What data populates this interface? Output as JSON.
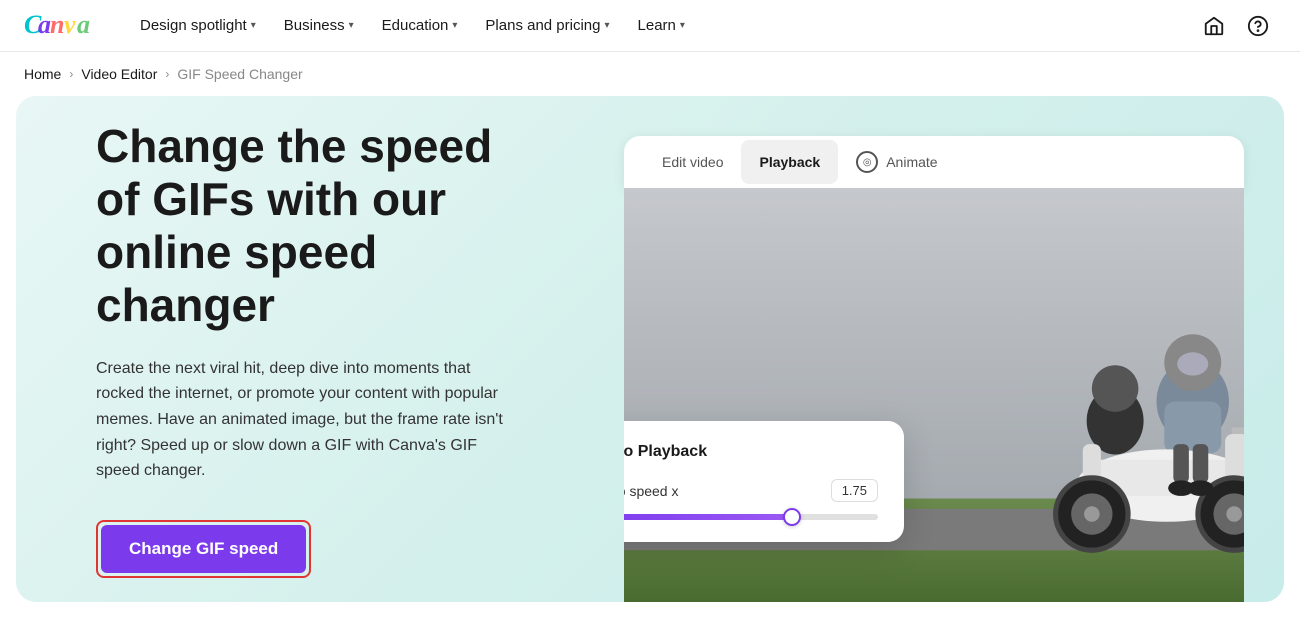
{
  "nav": {
    "logo_alt": "Canva",
    "links": [
      {
        "id": "design-spotlight",
        "label": "Design spotlight",
        "has_dropdown": true
      },
      {
        "id": "business",
        "label": "Business",
        "has_dropdown": true
      },
      {
        "id": "education",
        "label": "Education",
        "has_dropdown": true
      },
      {
        "id": "plans-pricing",
        "label": "Plans and pricing",
        "has_dropdown": true
      },
      {
        "id": "learn",
        "label": "Learn",
        "has_dropdown": true
      }
    ],
    "icon_home": "⌂",
    "icon_help": "?"
  },
  "breadcrumb": {
    "items": [
      {
        "id": "home",
        "label": "Home"
      },
      {
        "id": "video-editor",
        "label": "Video Editor"
      },
      {
        "id": "current",
        "label": "GIF Speed Changer"
      }
    ]
  },
  "hero": {
    "title": "Change the speed of GIFs with our online speed changer",
    "description": "Create the next viral hit, deep dive into moments that rocked the internet, or promote your content with popular memes. Have an animated image, but the frame rate isn't right? Speed up or slow down a GIF with Canva's GIF speed changer.",
    "cta_label": "Change GIF speed"
  },
  "ui_panel": {
    "tabs": [
      {
        "id": "edit-video",
        "label": "Edit video",
        "active": false
      },
      {
        "id": "playback",
        "label": "Playback",
        "active": true
      },
      {
        "id": "animate",
        "label": "Animate",
        "active": false
      }
    ],
    "playback": {
      "title": "Video Playback",
      "speed_label": "Video speed x",
      "speed_value": "1.75",
      "slider_percent": 70
    }
  }
}
